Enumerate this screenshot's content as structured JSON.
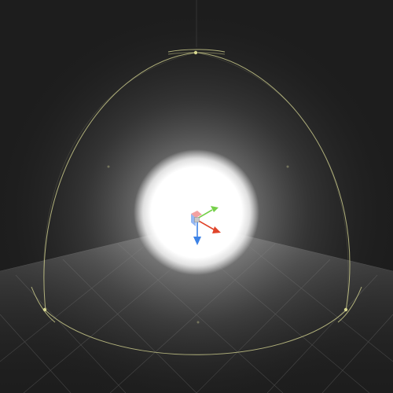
{
  "scene_view": {
    "background_color": "#1d1d1d",
    "grid": {
      "visible": true,
      "line_color": "#8a8a8a"
    },
    "selected_object": {
      "type": "point-light",
      "light_color": "#ffffff",
      "range_gizmo_color": "#c9c98a"
    },
    "transform_gizmo": {
      "tool": "move",
      "x_axis_color": "#e0442a",
      "y_axis_color": "#76d04a",
      "z_axis_color": "#3c82e6",
      "center_color": "#c8c8c8"
    }
  }
}
